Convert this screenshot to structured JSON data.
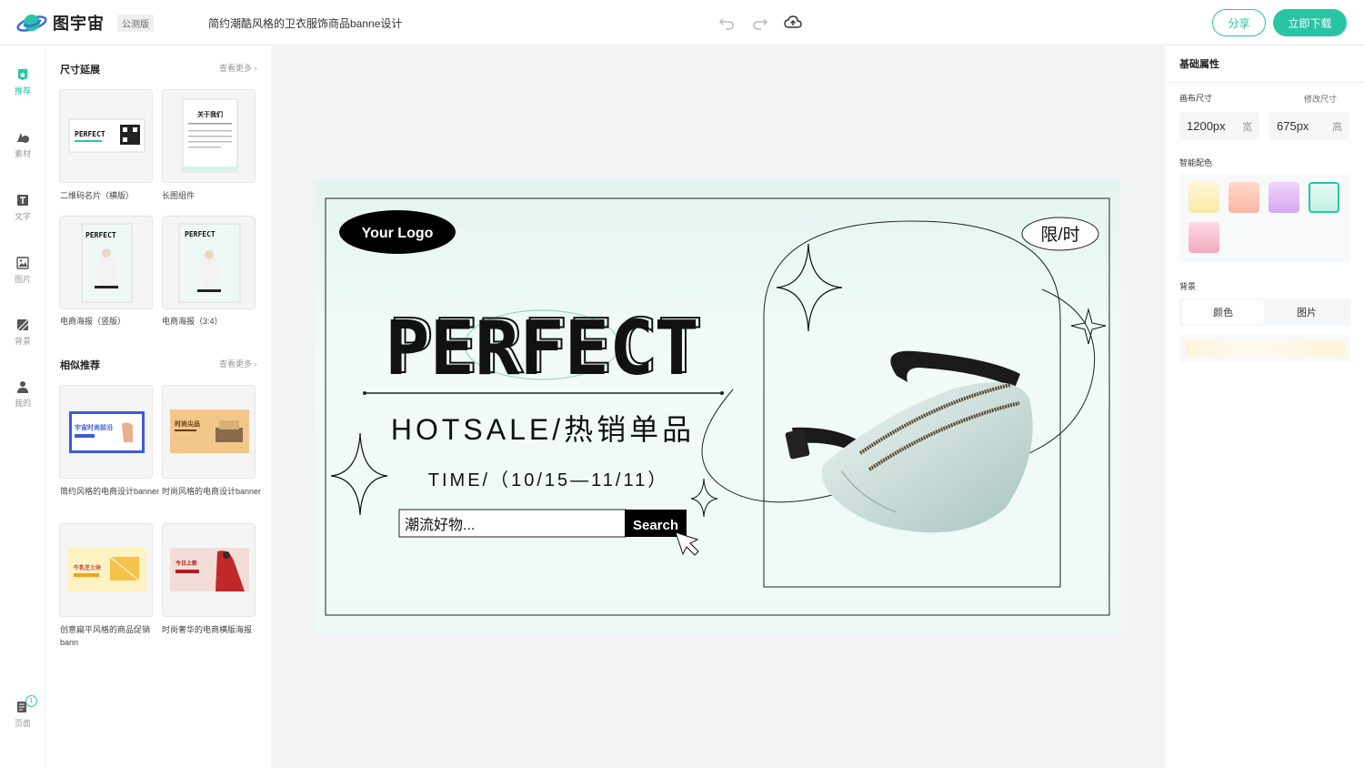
{
  "header": {
    "brand": "图宇宙",
    "beta": "公测版",
    "doc_title": "简约潮酷风格的卫衣服饰商品banne设计",
    "share_label": "分享",
    "download_label": "立即下载",
    "accent": "#29c4a4"
  },
  "rail": {
    "items": [
      {
        "label": "推荐",
        "icon": "recommend-icon"
      },
      {
        "label": "素材",
        "icon": "shapes-icon"
      },
      {
        "label": "文字",
        "icon": "text-icon"
      },
      {
        "label": "图片",
        "icon": "image-icon"
      },
      {
        "label": "背景",
        "icon": "background-icon"
      },
      {
        "label": "我的",
        "icon": "user-icon"
      }
    ],
    "pages_label": "页面",
    "pages_count": "1"
  },
  "templates": {
    "section1": {
      "title": "尺寸延展",
      "more": "查看更多"
    },
    "section2": {
      "title": "相似推荐",
      "more": "查看更多"
    },
    "cards": [
      {
        "label": "二维码名片（横版）"
      },
      {
        "label": "长图组件"
      },
      {
        "label": "电商海报（竖版）"
      },
      {
        "label": "电商海报（3:4）"
      },
      {
        "label": "简约风格的电商设计banner"
      },
      {
        "label": "时尚风格的电商设计banner"
      },
      {
        "label": "创意扁平风格的商品促销bann"
      },
      {
        "label": "时尚奢华的电商横版海报"
      }
    ],
    "thumb_text": {
      "perfect": "PERFECT",
      "about": "关于我们",
      "space_fashion": "宇宙时尚前沿",
      "fashion_item": "时尚尖品",
      "cheese": "牛乳芝士块",
      "new_today": "今日上新"
    }
  },
  "canvas": {
    "logo": "Your Logo",
    "limited": "限/时",
    "headline": "PERFECT",
    "hotsale": "HOTSALE/热销单品",
    "time": "TIME/（10/15—11/11）",
    "search_placeholder": "潮流好物...",
    "search_button": "Search"
  },
  "props": {
    "title": "基础属性",
    "canvas_size_label": "画布尺寸",
    "resize_link": "修改尺寸",
    "width_value": "1200px",
    "width_unit": "宽",
    "height_value": "675px",
    "height_unit": "高",
    "palette_label": "智能配色",
    "palette": [
      {
        "from": "#fff7d6",
        "to": "#fde9a8"
      },
      {
        "from": "#ffd9cc",
        "to": "#f8b8a2"
      },
      {
        "from": "#f0d4ff",
        "to": "#d6a8f0"
      },
      {
        "from": "#e8fbf6",
        "to": "#bff0e2"
      },
      {
        "from": "#ffd9e4",
        "to": "#f4aac2"
      }
    ],
    "background_label": "背景",
    "tab_color": "颜色",
    "tab_image": "图片"
  }
}
